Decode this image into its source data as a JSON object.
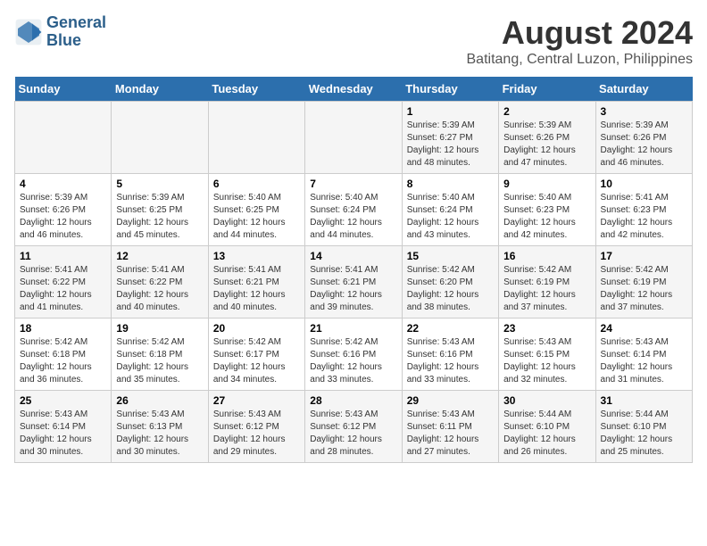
{
  "logo": {
    "line1": "General",
    "line2": "Blue"
  },
  "title": "August 2024",
  "subtitle": "Batitang, Central Luzon, Philippines",
  "days_of_week": [
    "Sunday",
    "Monday",
    "Tuesday",
    "Wednesday",
    "Thursday",
    "Friday",
    "Saturday"
  ],
  "weeks": [
    [
      {
        "day": "",
        "info": ""
      },
      {
        "day": "",
        "info": ""
      },
      {
        "day": "",
        "info": ""
      },
      {
        "day": "",
        "info": ""
      },
      {
        "day": "1",
        "info": "Sunrise: 5:39 AM\nSunset: 6:27 PM\nDaylight: 12 hours\nand 48 minutes."
      },
      {
        "day": "2",
        "info": "Sunrise: 5:39 AM\nSunset: 6:26 PM\nDaylight: 12 hours\nand 47 minutes."
      },
      {
        "day": "3",
        "info": "Sunrise: 5:39 AM\nSunset: 6:26 PM\nDaylight: 12 hours\nand 46 minutes."
      }
    ],
    [
      {
        "day": "4",
        "info": "Sunrise: 5:39 AM\nSunset: 6:26 PM\nDaylight: 12 hours\nand 46 minutes."
      },
      {
        "day": "5",
        "info": "Sunrise: 5:39 AM\nSunset: 6:25 PM\nDaylight: 12 hours\nand 45 minutes."
      },
      {
        "day": "6",
        "info": "Sunrise: 5:40 AM\nSunset: 6:25 PM\nDaylight: 12 hours\nand 44 minutes."
      },
      {
        "day": "7",
        "info": "Sunrise: 5:40 AM\nSunset: 6:24 PM\nDaylight: 12 hours\nand 44 minutes."
      },
      {
        "day": "8",
        "info": "Sunrise: 5:40 AM\nSunset: 6:24 PM\nDaylight: 12 hours\nand 43 minutes."
      },
      {
        "day": "9",
        "info": "Sunrise: 5:40 AM\nSunset: 6:23 PM\nDaylight: 12 hours\nand 42 minutes."
      },
      {
        "day": "10",
        "info": "Sunrise: 5:41 AM\nSunset: 6:23 PM\nDaylight: 12 hours\nand 42 minutes."
      }
    ],
    [
      {
        "day": "11",
        "info": "Sunrise: 5:41 AM\nSunset: 6:22 PM\nDaylight: 12 hours\nand 41 minutes."
      },
      {
        "day": "12",
        "info": "Sunrise: 5:41 AM\nSunset: 6:22 PM\nDaylight: 12 hours\nand 40 minutes."
      },
      {
        "day": "13",
        "info": "Sunrise: 5:41 AM\nSunset: 6:21 PM\nDaylight: 12 hours\nand 40 minutes."
      },
      {
        "day": "14",
        "info": "Sunrise: 5:41 AM\nSunset: 6:21 PM\nDaylight: 12 hours\nand 39 minutes."
      },
      {
        "day": "15",
        "info": "Sunrise: 5:42 AM\nSunset: 6:20 PM\nDaylight: 12 hours\nand 38 minutes."
      },
      {
        "day": "16",
        "info": "Sunrise: 5:42 AM\nSunset: 6:19 PM\nDaylight: 12 hours\nand 37 minutes."
      },
      {
        "day": "17",
        "info": "Sunrise: 5:42 AM\nSunset: 6:19 PM\nDaylight: 12 hours\nand 37 minutes."
      }
    ],
    [
      {
        "day": "18",
        "info": "Sunrise: 5:42 AM\nSunset: 6:18 PM\nDaylight: 12 hours\nand 36 minutes."
      },
      {
        "day": "19",
        "info": "Sunrise: 5:42 AM\nSunset: 6:18 PM\nDaylight: 12 hours\nand 35 minutes."
      },
      {
        "day": "20",
        "info": "Sunrise: 5:42 AM\nSunset: 6:17 PM\nDaylight: 12 hours\nand 34 minutes."
      },
      {
        "day": "21",
        "info": "Sunrise: 5:42 AM\nSunset: 6:16 PM\nDaylight: 12 hours\nand 33 minutes."
      },
      {
        "day": "22",
        "info": "Sunrise: 5:43 AM\nSunset: 6:16 PM\nDaylight: 12 hours\nand 33 minutes."
      },
      {
        "day": "23",
        "info": "Sunrise: 5:43 AM\nSunset: 6:15 PM\nDaylight: 12 hours\nand 32 minutes."
      },
      {
        "day": "24",
        "info": "Sunrise: 5:43 AM\nSunset: 6:14 PM\nDaylight: 12 hours\nand 31 minutes."
      }
    ],
    [
      {
        "day": "25",
        "info": "Sunrise: 5:43 AM\nSunset: 6:14 PM\nDaylight: 12 hours\nand 30 minutes."
      },
      {
        "day": "26",
        "info": "Sunrise: 5:43 AM\nSunset: 6:13 PM\nDaylight: 12 hours\nand 30 minutes."
      },
      {
        "day": "27",
        "info": "Sunrise: 5:43 AM\nSunset: 6:12 PM\nDaylight: 12 hours\nand 29 minutes."
      },
      {
        "day": "28",
        "info": "Sunrise: 5:43 AM\nSunset: 6:12 PM\nDaylight: 12 hours\nand 28 minutes."
      },
      {
        "day": "29",
        "info": "Sunrise: 5:43 AM\nSunset: 6:11 PM\nDaylight: 12 hours\nand 27 minutes."
      },
      {
        "day": "30",
        "info": "Sunrise: 5:44 AM\nSunset: 6:10 PM\nDaylight: 12 hours\nand 26 minutes."
      },
      {
        "day": "31",
        "info": "Sunrise: 5:44 AM\nSunset: 6:10 PM\nDaylight: 12 hours\nand 25 minutes."
      }
    ]
  ]
}
